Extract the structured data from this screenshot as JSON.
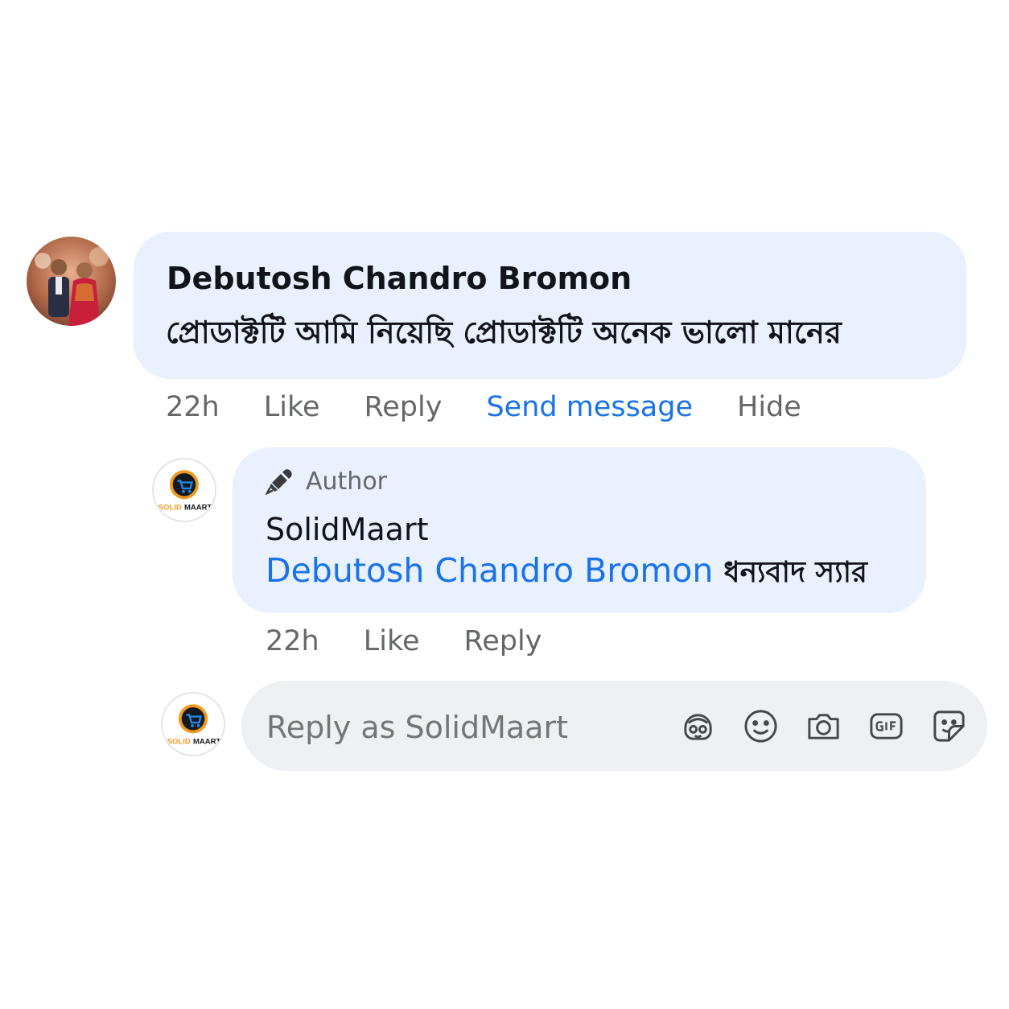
{
  "comment": {
    "author": "Debutosh Chandro Bromon",
    "text": "প্রোডাক্টটি আমি নিয়েছি প্রোডাক্টটি অনেক ভালো মানের",
    "actions": {
      "time": "22h",
      "like": "Like",
      "reply": "Reply",
      "send_message": "Send message",
      "hide": "Hide"
    }
  },
  "reply": {
    "badge": "Author",
    "author": "SolidMaart",
    "mention": "Debutosh Chandro Bromon",
    "text": "ধন্যবাদ স্যার",
    "actions": {
      "time": "22h",
      "like": "Like",
      "reply": "Reply"
    }
  },
  "composer": {
    "placeholder": "Reply as SolidMaart",
    "icons": [
      "avatar-sticker-icon",
      "emoji-icon",
      "camera-icon",
      "gif-icon",
      "sticker-icon"
    ]
  },
  "page_logo": {
    "line1": "SOLID",
    "line2": "MAART"
  },
  "colors": {
    "bubble": "#e8f1fd",
    "link_blue": "#1a73e8",
    "muted": "#65676b",
    "composer_bg": "#eef0f3"
  }
}
